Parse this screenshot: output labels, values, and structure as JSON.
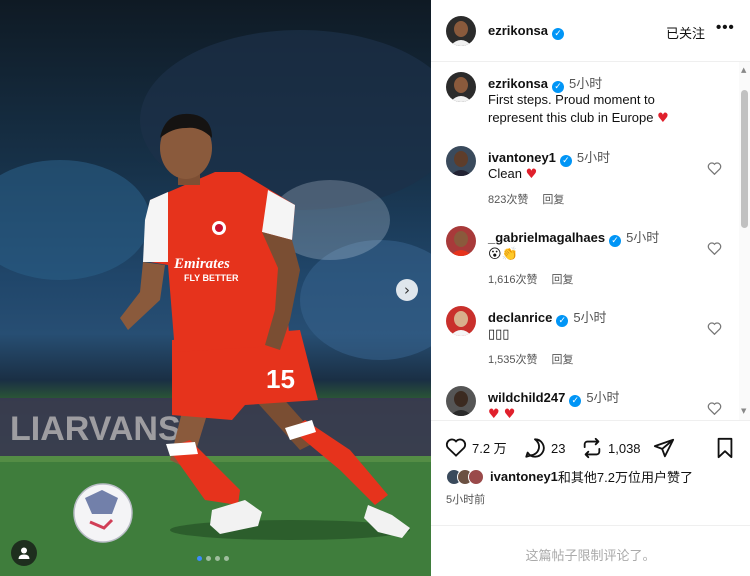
{
  "post": {
    "author": "ezrikonsa",
    "follow_status": "已关注",
    "more_label": "•••",
    "caption_time": "5小时",
    "caption_lines": [
      "First steps. Proud moment to",
      "represent this club in Europe"
    ],
    "caption_emoji": "♥"
  },
  "photo": {
    "next_glyph": "›",
    "carousel_dots": 4,
    "active_dot": 0,
    "jersey_sponsor_1": "Emirates",
    "jersey_sponsor_2": "FLY BETTER",
    "shirt_number": "15",
    "board_text": "LIARVANS"
  },
  "comments": [
    {
      "user": "ivantoney1",
      "verified": true,
      "time": "5小时",
      "text": "Clean ",
      "emoji": "♥",
      "likes": "823次赞",
      "reply": "回复"
    },
    {
      "user": "_gabrielmagalhaes",
      "verified": true,
      "time": "5小时",
      "text": "😮👏",
      "emoji": "",
      "likes": "1,616次赞",
      "reply": "回复"
    },
    {
      "user": "declanrice",
      "verified": true,
      "time": "5小时",
      "text": "▯▯▯",
      "emoji": "",
      "likes": "1,535次赞",
      "reply": "回复"
    },
    {
      "user": "wildchild247",
      "verified": true,
      "time": "5小时",
      "text": "",
      "emoji": "♥ ♥",
      "likes": "",
      "reply": ""
    }
  ],
  "actions": {
    "like_count": "7.2 万",
    "comment_count": "23",
    "repost_count": "1,038"
  },
  "likes_summary": {
    "user": "ivantoney1",
    "rest": "和其他7.2万位用户赞了"
  },
  "posted_ago": "5小时前",
  "comments_restricted": "这篇帖子限制评论了。",
  "colors": {
    "verified_blue": "#0095f6",
    "heart_red": "#e0202c",
    "kit_red": "#e6331c",
    "active_dot": "#3d8bfd"
  }
}
